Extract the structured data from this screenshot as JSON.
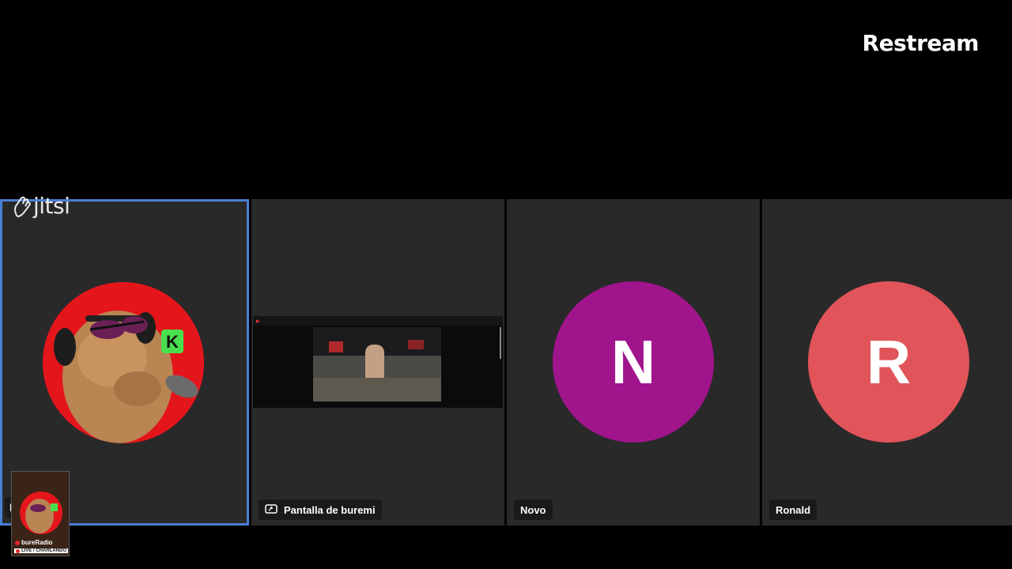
{
  "brand": {
    "name": "Restream"
  },
  "jitsi": {
    "logo_text": "jitsi"
  },
  "participants": [
    {
      "name": "b",
      "avatar_kind": "image",
      "active": true
    },
    {
      "name": "Pantalla de buremi",
      "avatar_kind": "screen-share"
    },
    {
      "name": "Novo",
      "initial": "N",
      "avatar_color": "#a0148c"
    },
    {
      "name": "Ronald",
      "initial": "R",
      "avatar_color": "#e0545a"
    }
  ],
  "overlay": {
    "channel": "bureRadio",
    "status": "LIVE / CHARLANDO"
  },
  "icons": {
    "screen_share": "screen-share-icon",
    "jitsi": "jitsi-hand-icon",
    "live": "live-dot-icon"
  },
  "colors": {
    "active_border": "#4a7fd6",
    "tile_bg": "#292929",
    "live_red": "#e0242e"
  }
}
